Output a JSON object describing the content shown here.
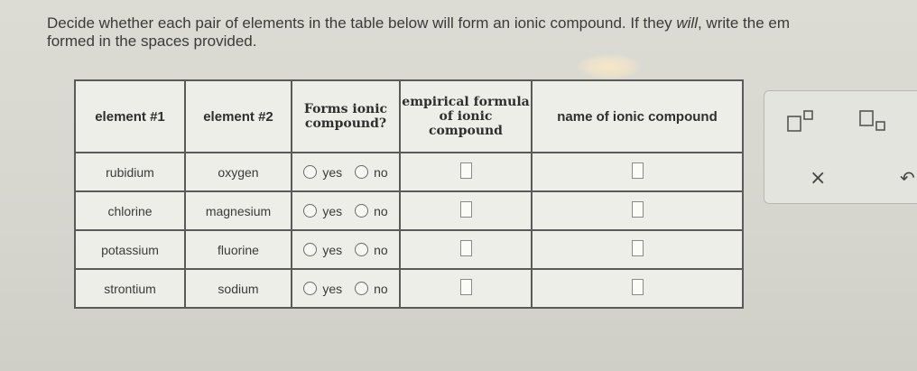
{
  "instructions": {
    "part1": "Decide whether each pair of elements in the table below will form an ionic compound. If they ",
    "will": "will",
    "part2": ", write the em",
    "line2": "formed in the spaces provided."
  },
  "table": {
    "headers": {
      "element1": "element #1",
      "element2": "element #2",
      "forms": "Forms ionic compound?",
      "formula": "empirical formula of ionic compound",
      "name": "name of ionic compound"
    },
    "yes_label": "yes",
    "no_label": "no",
    "rows": [
      {
        "element1": "rubidium",
        "element2": "oxygen"
      },
      {
        "element1": "chlorine",
        "element2": "magnesium"
      },
      {
        "element1": "potassium",
        "element2": "fluorine"
      },
      {
        "element1": "strontium",
        "element2": "sodium"
      }
    ]
  },
  "toolbar": {
    "superscript_icon": "superscript-icon",
    "subscript_icon": "subscript-icon",
    "clear": "×",
    "undo": "↶"
  }
}
